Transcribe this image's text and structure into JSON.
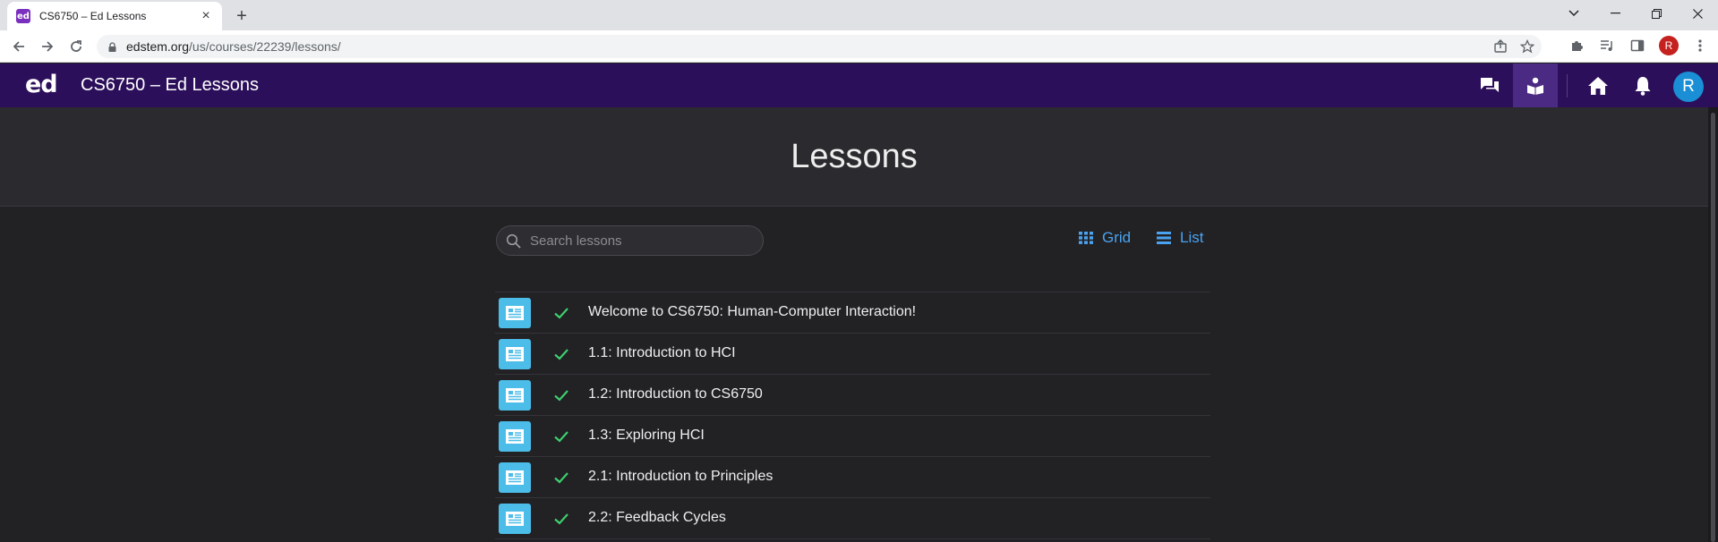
{
  "browser": {
    "tab_title": "CS6750 – Ed Lessons",
    "tab_favicon_text": "ed",
    "url_host": "edstem.org",
    "url_path": "/us/courses/22239/lessons/",
    "profile_initial": "R"
  },
  "app": {
    "logo": "ed",
    "title": "CS6750 – Ed Lessons",
    "avatar_initial": "R",
    "brand_color": "#2c0f5a",
    "accent_color": "#4aa3f0"
  },
  "page": {
    "heading": "Lessons",
    "search_placeholder": "Search lessons",
    "view_grid_label": "Grid",
    "view_list_label": "List"
  },
  "lessons": [
    {
      "title": "Welcome to CS6750: Human-Computer Interaction!",
      "completed": true
    },
    {
      "title": "1.1: Introduction to HCI",
      "completed": true
    },
    {
      "title": "1.2: Introduction to CS6750",
      "completed": true
    },
    {
      "title": "1.3: Exploring HCI",
      "completed": true
    },
    {
      "title": "2.1: Introduction to Principles",
      "completed": true
    },
    {
      "title": "2.2: Feedback Cycles",
      "completed": true
    }
  ]
}
